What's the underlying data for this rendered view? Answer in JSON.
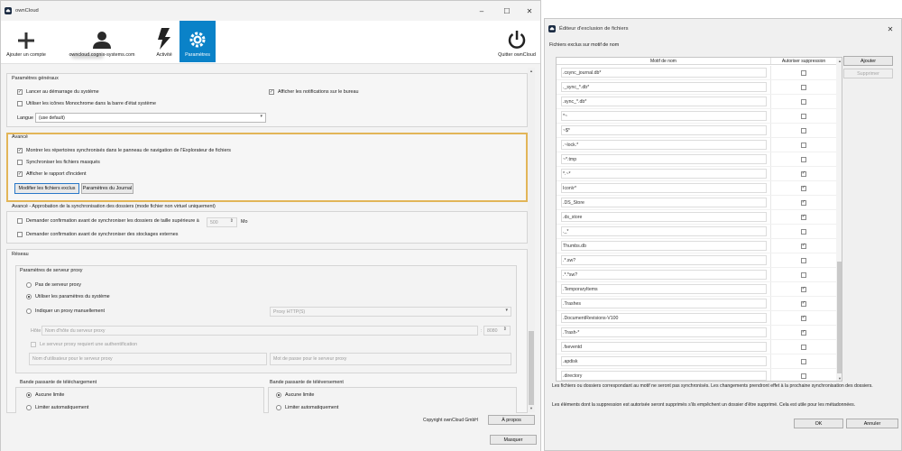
{
  "main_window": {
    "title": "ownCloud",
    "toolbar": {
      "add_account": "Ajouter un compte",
      "account": "owncloud.cognix-systems.com",
      "activity": "Activité",
      "settings": "Paramètres",
      "quit": "Quitter ownCloud"
    },
    "general": {
      "title": "Paramètres généraux",
      "launch_at_startup": "Lancer au démarrage du système",
      "show_notifications": "Afficher les notifications sur le bureau",
      "monochrome_icons": "Utiliser les icônes Monochrome dans la barre d'état système",
      "language_label": "Langue",
      "language_value": "(use default)"
    },
    "advanced": {
      "title": "Avancé",
      "show_in_explorer": "Montrer les répertoires synchronisés dans le panneau de navigation de l'Explorateur de fichiers",
      "sync_hidden": "Synchroniser les fichiers masqués",
      "show_crash_report": "Afficher le rapport d'incident",
      "edit_ignored_button": "Modifier les fichiers exclus",
      "log_settings_button": "Paramètres du Journal"
    },
    "new_folders": {
      "title": "Avancé - Approbation de la synchronisation des dossiers (mode fichier non virtuel uniquement)",
      "ask_large_folders": "Demander confirmation avant de synchroniser les dossiers de taille supérieure à",
      "size_value": "500",
      "size_unit": "Mo",
      "ask_external": "Demander confirmation avant de synchroniser des stockages externes"
    },
    "network": {
      "title": "Réseau",
      "proxy_title": "Paramètres de serveur proxy",
      "no_proxy": "Pas de serveur proxy",
      "system_proxy": "Utiliser les paramètres du système",
      "manual_proxy": "Indiquer un proxy manuellement",
      "proxy_type": "Proxy HTTP(S)",
      "host_label": "Hôte",
      "host_placeholder": "Nom d'hôte du serveur proxy",
      "port_value": "8080",
      "requires_auth": "Le serveur proxy requiert une authentification",
      "user_placeholder": "Nom d'utilisateur pour le serveur proxy",
      "password_placeholder": "Mot de passe pour le serveur proxy",
      "download_title": "Bande passante de téléchargement",
      "download_unlimited": "Aucune limite",
      "download_auto": "Limiter automatiquement",
      "upload_title": "Bande passante de téléversement",
      "upload_unlimited": "Aucune limite",
      "upload_auto": "Limiter automatiquement"
    },
    "footer": {
      "copyright": "Copyright ownCloud GmbH",
      "about_button": "À propos",
      "hide_button": "Masquer"
    }
  },
  "dialog": {
    "title": "Éditeur d'exclusion de fichiers",
    "subtitle": "Fichiers exclus sur motif de nom",
    "col_pattern": "Motif de nom",
    "col_allow_delete": "Autoriser suppression",
    "add_button": "Ajouter",
    "remove_button": "Supprimer",
    "rows": [
      {
        "pattern": ".csync_journal.db*",
        "checked": false
      },
      {
        "pattern": "._sync_*.db*",
        "checked": false
      },
      {
        "pattern": ".sync_*.db*",
        "checked": false
      },
      {
        "pattern": "*~",
        "checked": false
      },
      {
        "pattern": "~$*",
        "checked": false
      },
      {
        "pattern": ".~lock.*",
        "checked": false
      },
      {
        "pattern": "~*.tmp",
        "checked": false
      },
      {
        "pattern": "*.~*",
        "checked": true
      },
      {
        "pattern": "Icon\\r*",
        "checked": true
      },
      {
        "pattern": ".DS_Store",
        "checked": true
      },
      {
        "pattern": ".ds_store",
        "checked": true
      },
      {
        "pattern": "._*",
        "checked": false
      },
      {
        "pattern": "Thumbs.db",
        "checked": true
      },
      {
        "pattern": ".*.sw?",
        "checked": false
      },
      {
        "pattern": ".*.*sw?",
        "checked": false
      },
      {
        "pattern": ".TemporaryItems",
        "checked": true
      },
      {
        "pattern": ".Trashes",
        "checked": true
      },
      {
        "pattern": ".DocumentRevisions-V100",
        "checked": true
      },
      {
        "pattern": ".Trash-*",
        "checked": true
      },
      {
        "pattern": ".fseventd",
        "checked": false
      },
      {
        "pattern": ".apdisk",
        "checked": false
      },
      {
        "pattern": ".directory",
        "checked": false
      }
    ],
    "info1": "Les fichiers ou dossiers correspondant au motif ne seront pas synchronisés. Les changements prendront effet à la prochaine synchronisation des dossiers.",
    "info2": "Les éléments dont la suppression est autorisée seront supprimés s'ils empêchent un dossier d'être supprimé. Cela est utile pour les métadonnées.",
    "ok_button": "OK",
    "cancel_button": "Annuler"
  },
  "colors": {
    "accent": "#0a82c8",
    "highlight": "#e2b558"
  }
}
